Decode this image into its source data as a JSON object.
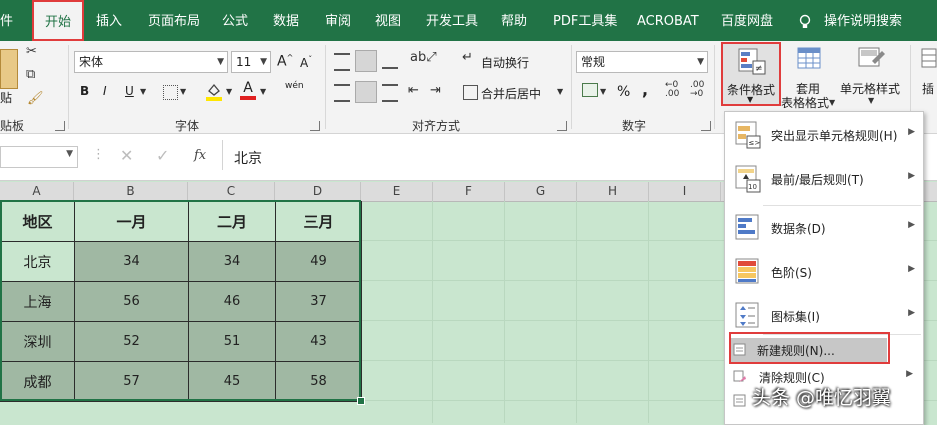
{
  "tabs": [
    {
      "label": "件"
    },
    {
      "label": "开始",
      "active": true
    },
    {
      "label": "插入"
    },
    {
      "label": "页面布局"
    },
    {
      "label": "公式"
    },
    {
      "label": "数据"
    },
    {
      "label": "审阅"
    },
    {
      "label": "视图"
    },
    {
      "label": "开发工具"
    },
    {
      "label": "帮助"
    },
    {
      "label": "PDF工具集"
    },
    {
      "label": "ACROBAT"
    },
    {
      "label": "百度网盘"
    },
    {
      "label": "操作说明搜索"
    }
  ],
  "ribbon": {
    "clipboard": {
      "paste_label": "贴",
      "group_label": "贴板"
    },
    "font": {
      "font_name": "宋体",
      "font_size": "11",
      "bold": "B",
      "italic": "I",
      "underline": "U",
      "group_label": "字体",
      "grow": "A",
      "shrink": "A",
      "color_letter": "A",
      "phonetic": "wén"
    },
    "alignment": {
      "wrap_label": "自动换行",
      "merge_label": "合并后居中",
      "group_label": "对齐方式"
    },
    "number": {
      "format": "常规",
      "percent": "%",
      "comma": ",",
      "group_label": "数字"
    },
    "styles": {
      "cond_format_label": "条件格式",
      "table_label_1": "套用",
      "table_label_2": "表格格式",
      "cell_styles_label": "单元格样式"
    }
  },
  "formula_bar": {
    "name_box": "",
    "fx": "fx",
    "content": "北京"
  },
  "columns": [
    "A",
    "B",
    "C",
    "D",
    "E",
    "F",
    "G",
    "H",
    "I"
  ],
  "table": {
    "headers": [
      "地区",
      "一月",
      "二月",
      "三月"
    ],
    "rows": [
      [
        "北京",
        "34",
        "34",
        "49"
      ],
      [
        "上海",
        "56",
        "46",
        "37"
      ],
      [
        "深圳",
        "52",
        "51",
        "43"
      ],
      [
        "成都",
        "57",
        "45",
        "58"
      ]
    ]
  },
  "menu": {
    "items": [
      {
        "label": "突出显示单元格规则(H)"
      },
      {
        "label": "最前/最后规则(T)"
      },
      {
        "label": "数据条(D)"
      },
      {
        "label": "色阶(S)"
      },
      {
        "label": "图标集(I)"
      }
    ],
    "new_rule": "新建规则(N)...",
    "clear_rules": "清除规则(C)",
    "icon_badge_1": "≤>",
    "icon_badge_2": "10"
  },
  "watermark": "头条 @唯忆羽翼",
  "colors": {
    "brand": "#217346",
    "highlight_box": "#e03c3c",
    "sheet_bg": "#c9e6cf",
    "data_fill": "#a0b8a3",
    "header_fill": "#c9e6cf"
  }
}
